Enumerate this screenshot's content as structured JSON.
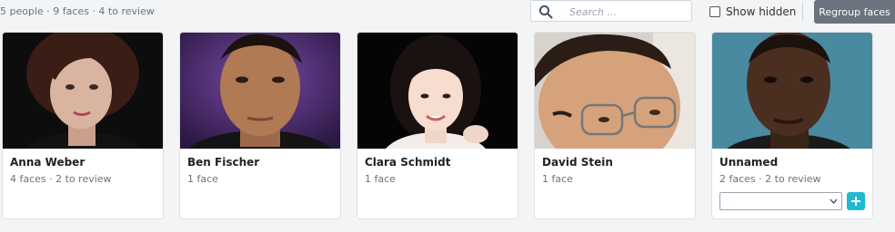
{
  "summary": "5 people · 9 faces · 4 to review",
  "search": {
    "placeholder": "Search ..."
  },
  "show_hidden": {
    "label": "Show hidden",
    "checked": false
  },
  "regroup_label": "Regroup faces",
  "colors": {
    "accent": "#22b8cf",
    "button_gray": "#6b7280"
  },
  "people": [
    {
      "name": "Anna Weber",
      "meta": "4 faces · 2 to review"
    },
    {
      "name": "Ben Fischer",
      "meta": "1 face"
    },
    {
      "name": "Clara Schmidt",
      "meta": "1 face"
    },
    {
      "name": "David Stein",
      "meta": "1 face"
    },
    {
      "name": "Unnamed",
      "meta": "2 faces · 2 to review",
      "assign_value": ""
    }
  ]
}
